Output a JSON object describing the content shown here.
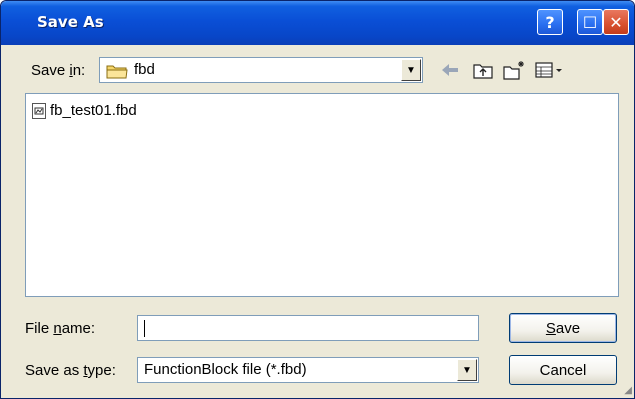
{
  "window": {
    "title": "Save As",
    "help_label": "?",
    "maximize_label": "☐",
    "close_label": "✕"
  },
  "save_in": {
    "label_prefix": "Save ",
    "label_accel": "i",
    "label_suffix": "n:",
    "value": "fbd"
  },
  "toolbar": {
    "back_icon": "back-arrow-icon",
    "up_icon": "up-folder-icon",
    "new_folder_icon": "new-folder-icon",
    "view_menu_icon": "view-menu-icon"
  },
  "file_list": {
    "items": [
      {
        "name": "fb_test01.fbd",
        "icon": "fbd-file-icon"
      }
    ]
  },
  "file_name": {
    "label_prefix": "File ",
    "label_accel": "n",
    "label_suffix": "ame:",
    "value": ""
  },
  "save_as_type": {
    "label_prefix": "Save as ",
    "label_accel": "t",
    "label_suffix": "ype:",
    "value": "FunctionBlock file (*.fbd)"
  },
  "buttons": {
    "save_accel": "S",
    "save_rest": "ave",
    "cancel": "Cancel"
  },
  "colors": {
    "titlebar": "#0a4fd6",
    "dialog_bg": "#ece9d8",
    "field_border": "#7f9db9"
  }
}
